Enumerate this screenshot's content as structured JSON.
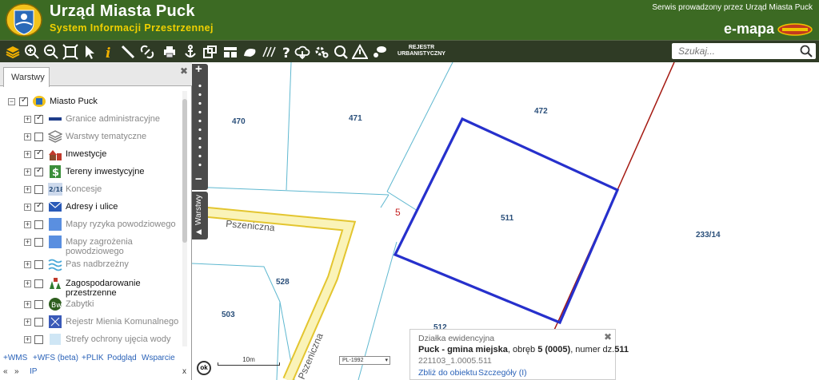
{
  "header": {
    "title": "Urząd Miasta Puck",
    "subtitle": "System Informacji Przestrzennej",
    "serwis": "Serwis prowadzony przez Urząd Miasta Puck",
    "brand": "e-mapa",
    "colors": {
      "bar": "#3c6a23",
      "toolbar": "#2f3b25",
      "subtitle": "#f0d000"
    }
  },
  "toolbar": {
    "rejestr_line1": "REJESTR",
    "rejestr_line2": "URBANISTYCZNY",
    "icons": [
      "layers-icon",
      "zoom-in-icon",
      "zoom-out-icon",
      "zoom-extent-icon",
      "pointer-icon",
      "info-icon",
      "measure-icon",
      "link-icon",
      "print-icon",
      "anchor-icon",
      "export-icon",
      "layout-icon",
      "draw-icon",
      "hatch-icon",
      "help-icon",
      "cloud-download-icon",
      "settings-icon",
      "search-map-icon",
      "warning-icon",
      "comment-icon"
    ]
  },
  "search": {
    "placeholder": "Szukaj..."
  },
  "panel": {
    "tab": "Warstwy",
    "root": "Miasto Puck",
    "items": [
      {
        "label": "Granice administracyjne",
        "checked": true,
        "dark": false
      },
      {
        "label": "Warstwy tematyczne",
        "checked": false,
        "dark": false
      },
      {
        "label": "Inwestycje",
        "checked": true,
        "dark": true
      },
      {
        "label": "Tereny inwestycyjne",
        "checked": true,
        "dark": true
      },
      {
        "label": "Koncesje",
        "checked": false,
        "dark": false,
        "icon_text": "2/18"
      },
      {
        "label": "Adresy i ulice",
        "checked": true,
        "dark": true
      },
      {
        "label": "Mapy ryzyka powodziowego",
        "checked": false,
        "dark": false
      },
      {
        "label": "Mapy zagrożenia",
        "label2": "powodziowego",
        "checked": false,
        "dark": false
      },
      {
        "label": "Pas nadbrzeżny",
        "checked": false,
        "dark": false
      },
      {
        "label": "Zagospodarowanie",
        "label2": "przestrzenne",
        "checked": false,
        "dark": true
      },
      {
        "label": "Zabytki",
        "checked": false,
        "dark": false
      },
      {
        "label": "Rejestr Mienia Komunalnego",
        "checked": false,
        "dark": false
      },
      {
        "label": "Strefy ochrony ujęcia wody",
        "checked": false,
        "dark": false
      }
    ],
    "links": {
      "wms": "+WMS",
      "wfs": "+WFS (beta)",
      "plik": "+PLIK",
      "podglad": "Podgląd",
      "wsparcie": "Wsparcie",
      "ip": "IP",
      "nav_left": "«",
      "nav_right": "»",
      "close": "x"
    }
  },
  "map": {
    "parcels": [
      "470",
      "471",
      "472",
      "511",
      "233/14",
      "528",
      "503",
      "512"
    ],
    "street": "Pszeniczna",
    "obreb_label": "5",
    "side_tab": "Warstwy",
    "scale": "10m",
    "projection": "PL-1992",
    "ok": "ok"
  },
  "popup": {
    "heading": "Działka ewidencyjna",
    "gmina": "Puck - gmina miejska",
    "obreb_text": ", obręb ",
    "obreb": "5 (0005)",
    "numer_text": ", numer dz.",
    "numer": "511",
    "id": "221103_1.0005.511",
    "zoom_link": "Zbliż do obiektu",
    "details_link": "Szczegóły (I)"
  }
}
